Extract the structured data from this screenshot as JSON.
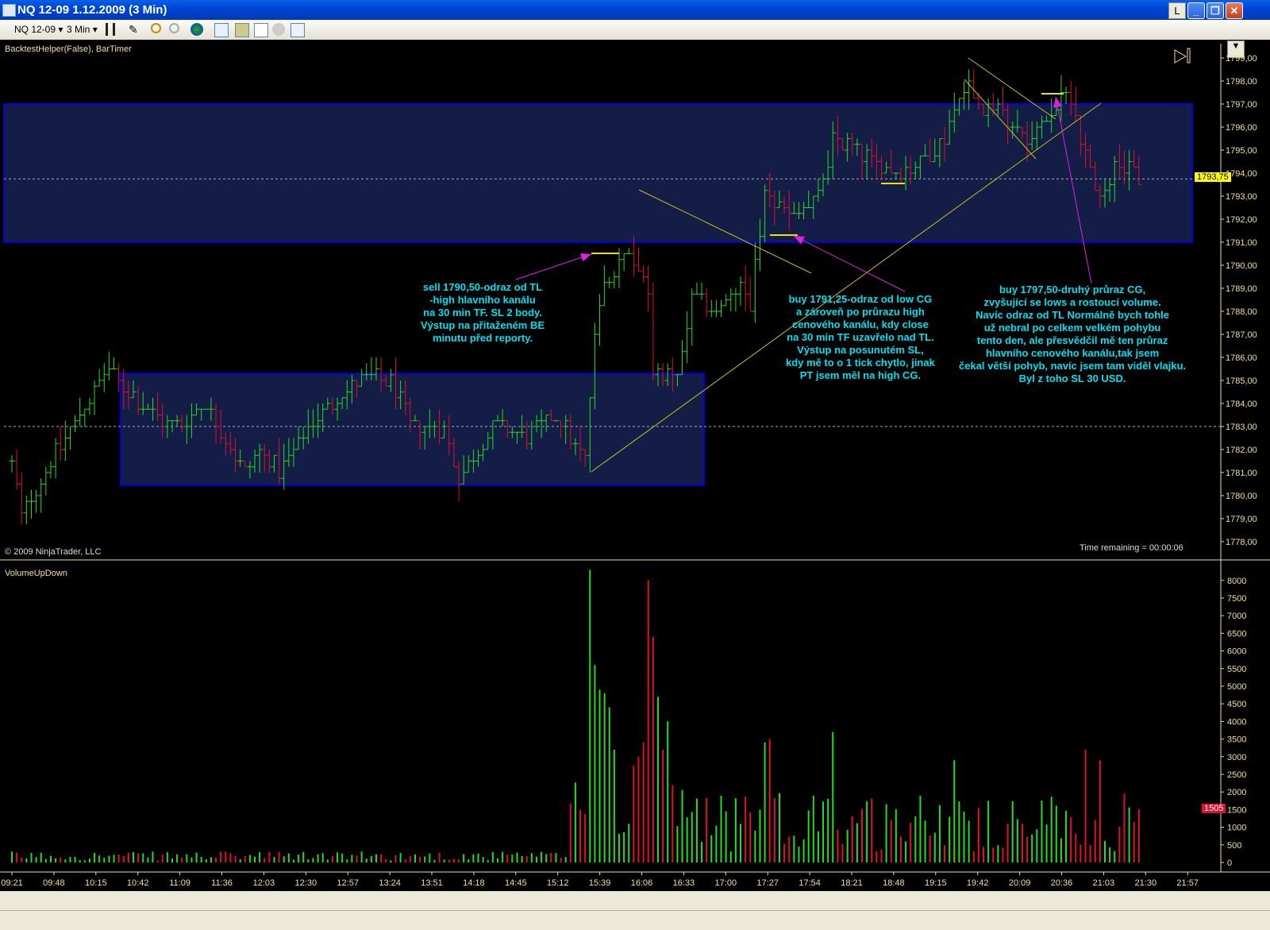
{
  "window": {
    "title": "NQ 12-09  1.12.2009 (3 Min)",
    "btn_l": "L",
    "btn_min": "_",
    "btn_max": "❐",
    "btn_close": "✕"
  },
  "toolbar": {
    "instrument": "NQ 12-09",
    "interval": "3 Min",
    "dropdown_arrow": "▾"
  },
  "indicators_label": "BacktestHelper(False), BarTimer",
  "copyright": "© 2009 NinjaTrader, LLC",
  "time_remaining": "Time remaining = 00:00:06",
  "volume_panel_label": "VolumeUpDown",
  "last_price": "1793,75",
  "last_volume": "1505",
  "colors": {
    "up": "#22dd22",
    "down": "#e01030",
    "channel_fill": "#131d45",
    "channel_border": "#0000e0",
    "trendline": "#c8c020",
    "arrow": "#e020e0",
    "axis": "#f0e090",
    "note": "#00e0f0"
  },
  "price_axis": {
    "min": 1778,
    "max": 1799,
    "step": 1
  },
  "volume_axis": {
    "min": 0,
    "max": 8000,
    "step": 500
  },
  "time_labels": [
    "09:21",
    "09:48",
    "10:15",
    "10:42",
    "11:09",
    "11:36",
    "12:03",
    "12:30",
    "12:57",
    "13:24",
    "13:51",
    "14:18",
    "14:45",
    "15:12",
    "15:39",
    "16:06",
    "16:33",
    "17:00",
    "17:27",
    "17:54",
    "18:21",
    "18:48",
    "19:15",
    "19:42",
    "20:09",
    "20:36",
    "21:03",
    "21:30",
    "21:57"
  ],
  "notes": [
    "sell 1790,50-odraz od TL\n-high hlavního kanálu\nna 30 min TF. SL 2 body.\nVýstup na přitaženém BE\nminutu před reporty.",
    "buy 1791,25-odraz od low CG\na zároveň po průrazu high\ncenového kanálu, kdy close\nna 30 min TF uzavřelo nad TL.\nVýstup na posunutém SL,\nkdy mě to o 1 tick chytlo, jinak\nPT jsem měl na high CG.",
    "buy 1797,50-druhý průraz CG,\nzvyšující se lows a rostoucí volume.\nNavíc odraz od TL Normálně bych tohle\nuž nebral po celkem velkém pohybu\ntento den, ale přesvědčil mě ten průraz\nhlavního cenového kanálu,tak jsem\nčekal větší pohyb, navíc jsem tam viděl vlajku.\nByl z toho SL 30 USD."
  ],
  "chart_data": {
    "type": "ohlc",
    "bar_minutes": 3,
    "bar_count": 242,
    "close_anchors": [
      [
        0,
        1781.5
      ],
      [
        2,
        1779
      ],
      [
        4,
        1780
      ],
      [
        11,
        1782.5
      ],
      [
        20,
        1785.5
      ],
      [
        22,
        1785
      ],
      [
        29,
        1783.5
      ],
      [
        34,
        1783
      ],
      [
        40,
        1784
      ],
      [
        48,
        1781
      ],
      [
        51,
        1782
      ],
      [
        55,
        1781
      ],
      [
        63,
        1783.5
      ],
      [
        71,
        1785
      ],
      [
        78,
        1785
      ],
      [
        82,
        1783
      ],
      [
        89,
        1783
      ],
      [
        92,
        1780.8
      ],
      [
        96,
        1782
      ],
      [
        99,
        1783
      ],
      [
        106,
        1782.5
      ],
      [
        112,
        1783.5
      ],
      [
        118,
        1781.5
      ],
      [
        120,
        1787
      ],
      [
        122,
        1789.5
      ],
      [
        127,
        1790.5
      ],
      [
        131,
        1789
      ],
      [
        132,
        1785.5
      ],
      [
        137,
        1785
      ],
      [
        140,
        1788.5
      ],
      [
        145,
        1788
      ],
      [
        150,
        1789
      ],
      [
        152,
        1788.5
      ],
      [
        155,
        1793
      ],
      [
        161,
        1792
      ],
      [
        166,
        1793
      ],
      [
        169,
        1795.5
      ],
      [
        174,
        1795
      ],
      [
        177,
        1794.5
      ],
      [
        182,
        1794
      ],
      [
        187,
        1794.5
      ],
      [
        192,
        1795.5
      ],
      [
        195,
        1797.5
      ],
      [
        197,
        1798
      ],
      [
        200,
        1797
      ],
      [
        205,
        1796.5
      ],
      [
        210,
        1795.5
      ],
      [
        215,
        1797
      ],
      [
        218,
        1797.5
      ],
      [
        220,
        1795.5
      ],
      [
        224,
        1793
      ],
      [
        228,
        1794.5
      ],
      [
        232,
        1793.75
      ]
    ],
    "channels": [
      {
        "from": 0,
        "to": 245,
        "low": 1791,
        "high": 1797
      },
      {
        "from": 22,
        "to": 142,
        "low": 1780.45,
        "high": 1785.3
      }
    ],
    "reference_lines": [
      1793.75,
      1783
    ],
    "volume_spikes": [
      [
        119,
        8300
      ],
      [
        120,
        5600
      ],
      [
        121,
        4900
      ],
      [
        122,
        4800
      ],
      [
        123,
        4400
      ],
      [
        124,
        3200
      ],
      [
        129,
        3000
      ],
      [
        130,
        3400
      ],
      [
        131,
        8000
      ],
      [
        132,
        6400
      ],
      [
        133,
        4700
      ],
      [
        134,
        3200
      ],
      [
        135,
        4000
      ],
      [
        169,
        3700
      ],
      [
        156,
        3500
      ],
      [
        155,
        3400
      ],
      [
        194,
        2900
      ],
      [
        221,
        3200
      ],
      [
        224,
        2900
      ],
      [
        232,
        1505
      ]
    ]
  }
}
